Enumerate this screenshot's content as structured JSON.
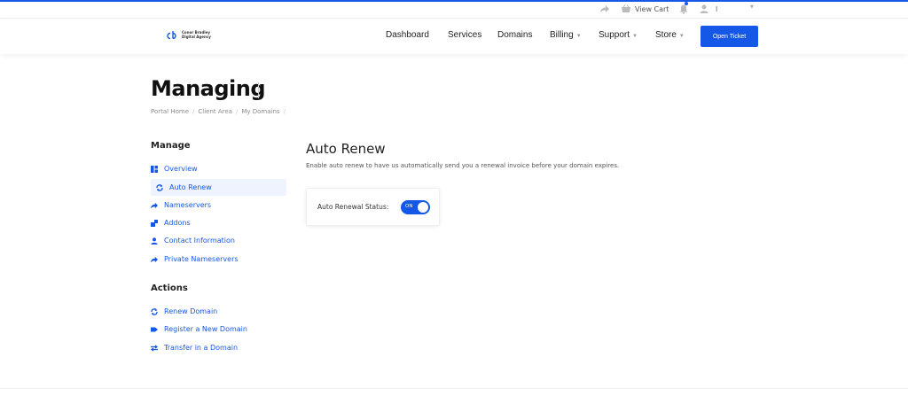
{
  "topbar": {
    "view_cart": "View Cart",
    "user": "l"
  },
  "brand": {
    "line1": "Conor Bradley",
    "line2": "Digital Agency",
    "accent": "#1557e6"
  },
  "nav": {
    "dashboard": "Dashboard",
    "services": "Services",
    "domains": "Domains",
    "billing": "Billing",
    "support": "Support",
    "store": "Store",
    "open_ticket": "Open Ticket"
  },
  "page": {
    "title": "Managing",
    "breadcrumb": [
      "Portal Home",
      "Client Area",
      "My Domains"
    ]
  },
  "sidebar": {
    "manage_heading": "Manage",
    "manage_items": [
      {
        "label": "Overview",
        "icon": "dashboard-icon"
      },
      {
        "label": "Auto Renew",
        "icon": "sync-icon"
      },
      {
        "label": "Nameservers",
        "icon": "share-arrow-icon"
      },
      {
        "label": "Addons",
        "icon": "cubes-icon"
      },
      {
        "label": "Contact Information",
        "icon": "user-icon"
      },
      {
        "label": "Private Nameservers",
        "icon": "share-arrow-icon"
      }
    ],
    "actions_heading": "Actions",
    "action_items": [
      {
        "label": "Renew Domain",
        "icon": "sync-icon"
      },
      {
        "label": "Register a New Domain",
        "icon": "tag-icon"
      },
      {
        "label": "Transfer in a Domain",
        "icon": "exchange-icon"
      }
    ]
  },
  "main": {
    "heading": "Auto Renew",
    "description": "Enable auto renew to have us automatically send you a renewal invoice before your domain expires.",
    "status_label": "Auto Renewal Status:",
    "toggle_text": "ON"
  }
}
